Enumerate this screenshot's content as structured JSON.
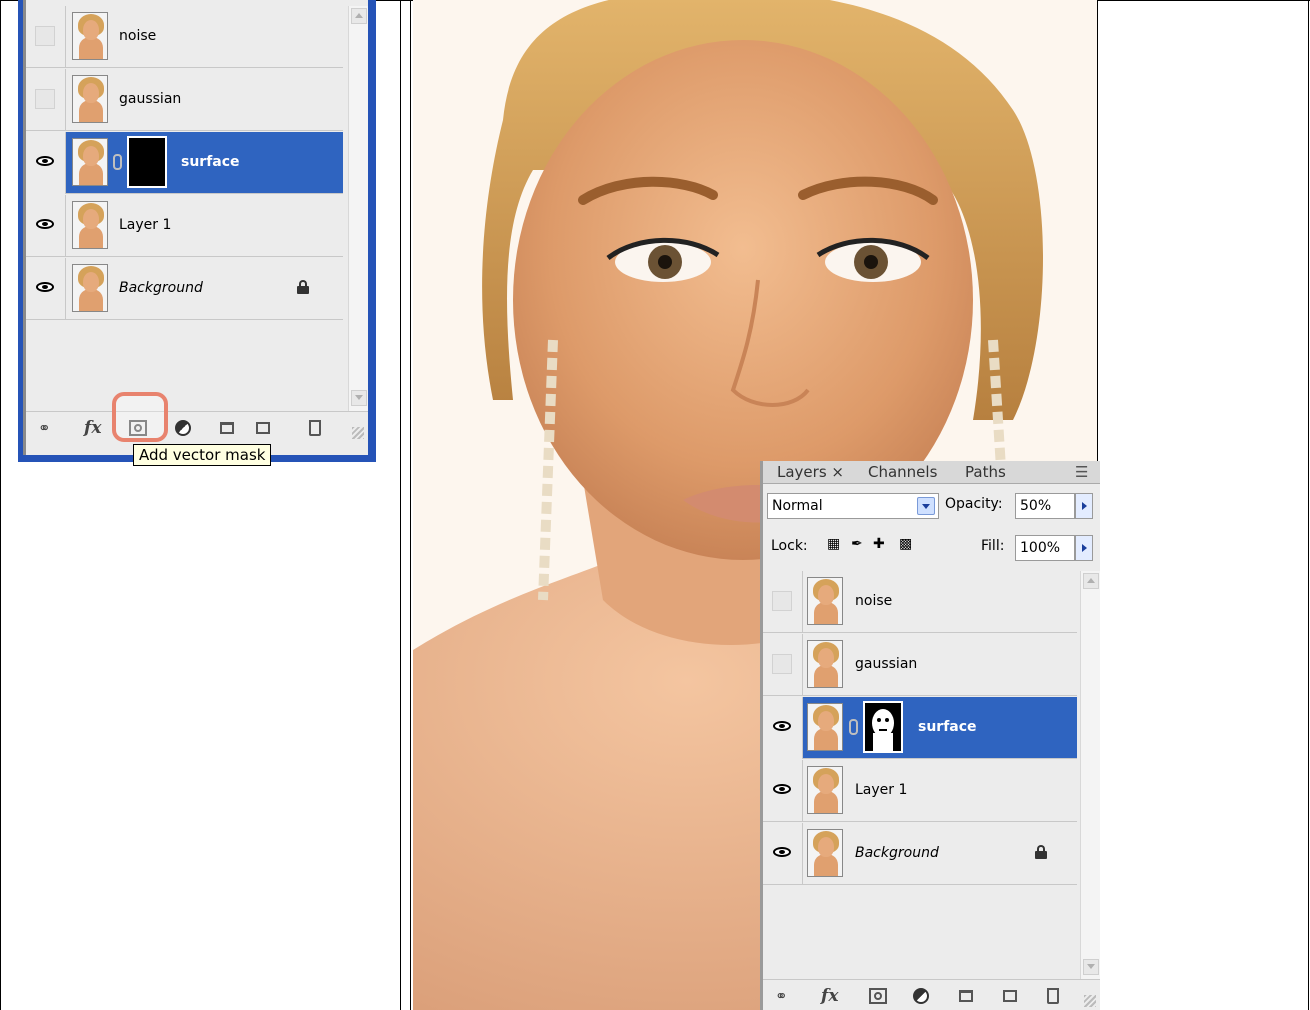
{
  "tooltip": "Add vector mask",
  "left_panel": {
    "layers": [
      {
        "name": "noise",
        "visible": false,
        "selected": false,
        "has_mask": false,
        "italic": false,
        "locked": false
      },
      {
        "name": "gaussian",
        "visible": false,
        "selected": false,
        "has_mask": false,
        "italic": false,
        "locked": false
      },
      {
        "name": "surface",
        "visible": true,
        "selected": true,
        "has_mask": true,
        "mask": "black",
        "italic": false,
        "locked": false
      },
      {
        "name": "Layer 1",
        "visible": true,
        "selected": false,
        "has_mask": false,
        "italic": false,
        "locked": false
      },
      {
        "name": "Background",
        "visible": true,
        "selected": false,
        "has_mask": false,
        "italic": true,
        "locked": true
      }
    ],
    "footer_icons": [
      "link-layers-icon",
      "fx-icon",
      "add-vector-mask-icon",
      "adjustment-layer-icon",
      "new-group-icon",
      "new-layer-icon",
      "trash-icon"
    ],
    "fx_label": "fx",
    "highlighted_icon": "add-vector-mask-icon"
  },
  "right_panel": {
    "tabs": [
      "Layers ×",
      "Channels",
      "Paths"
    ],
    "blend_mode": "Normal",
    "opacity_label": "Opacity:",
    "opacity_value": "50%",
    "lock_label": "Lock:",
    "fill_label": "Fill:",
    "fill_value": "100%",
    "layers": [
      {
        "name": "noise",
        "visible": false,
        "selected": false,
        "has_mask": false,
        "italic": false,
        "locked": false
      },
      {
        "name": "gaussian",
        "visible": false,
        "selected": false,
        "has_mask": false,
        "italic": false,
        "locked": false
      },
      {
        "name": "surface",
        "visible": true,
        "selected": true,
        "has_mask": true,
        "mask": "face-white",
        "italic": false,
        "locked": false
      },
      {
        "name": "Layer 1",
        "visible": true,
        "selected": false,
        "has_mask": false,
        "italic": false,
        "locked": false
      },
      {
        "name": "Background",
        "visible": true,
        "selected": false,
        "has_mask": false,
        "italic": true,
        "locked": true
      }
    ],
    "fx_label": "fx"
  },
  "colors": {
    "selection_blue": "#2f64c0",
    "panel_bg": "#ececec",
    "window_frame_blue": "#2553b7",
    "highlight_ring": "#e8836e",
    "tooltip_bg": "#ffffe1"
  }
}
